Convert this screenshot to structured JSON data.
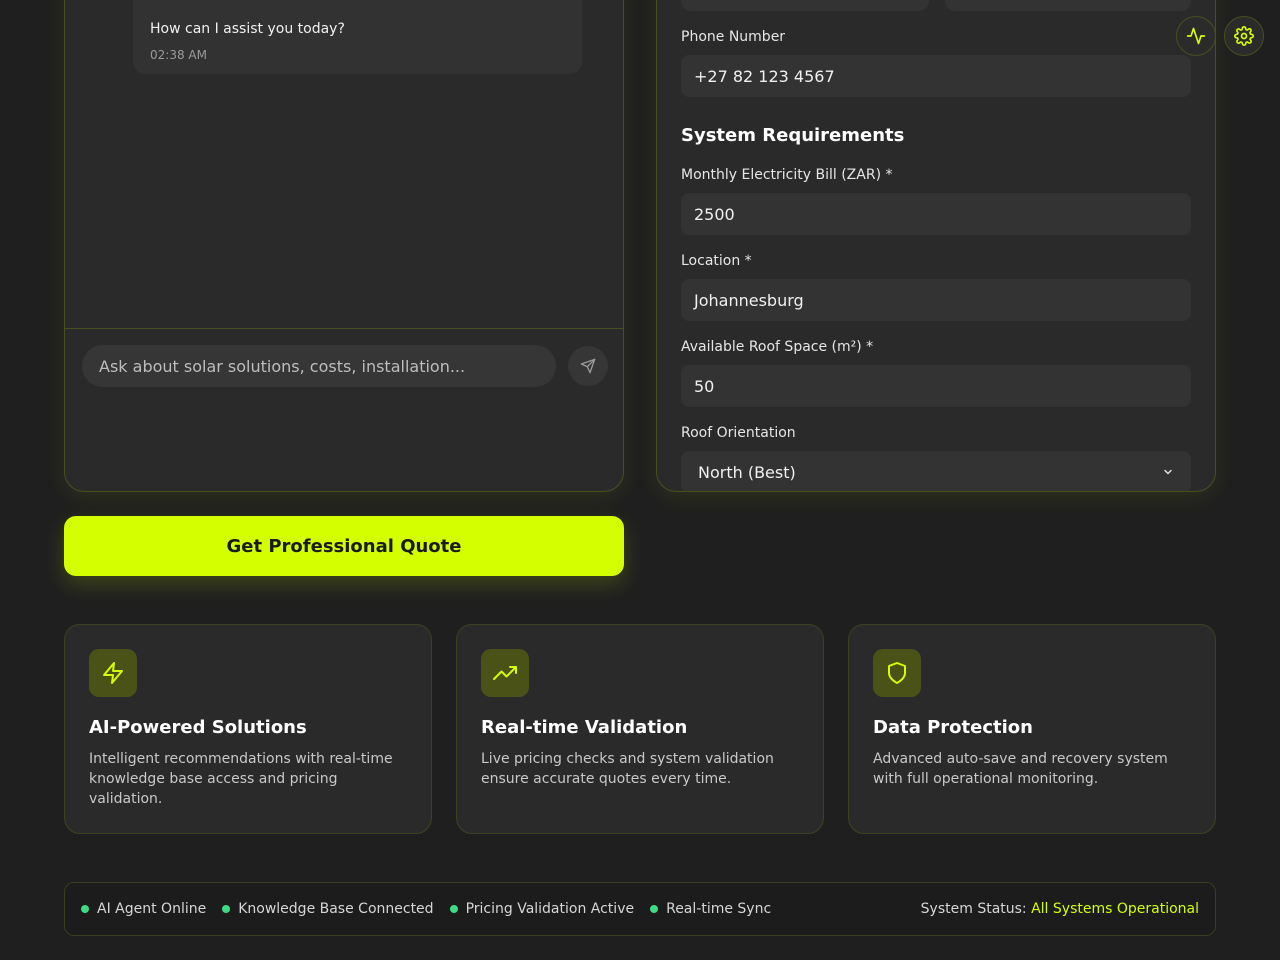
{
  "chat": {
    "message_text": "How can I assist you today?",
    "message_time": "02:38 AM",
    "input_placeholder": "Ask about solar solutions, costs, installation..."
  },
  "form": {
    "phone_label": "Phone Number",
    "phone_value": "+27 82 123 4567",
    "section_title": "System Requirements",
    "bill_label": "Monthly Electricity Bill (ZAR) *",
    "bill_value": "2500",
    "location_label": "Location *",
    "location_value": "Johannesburg",
    "roof_space_label": "Available Roof Space (m²) *",
    "roof_space_value": "50",
    "orientation_label": "Roof Orientation",
    "orientation_value": "North (Best)"
  },
  "quote_button": "Get Professional Quote",
  "features": [
    {
      "icon": "lightning-icon",
      "title": "AI-Powered Solutions",
      "desc": "Intelligent recommendations with real-time knowledge base access and pricing validation."
    },
    {
      "icon": "trending-up-icon",
      "title": "Real-time Validation",
      "desc": "Live pricing checks and system validation ensure accurate quotes every time."
    },
    {
      "icon": "shield-icon",
      "title": "Data Protection",
      "desc": "Advanced auto-save and recovery system with full operational monitoring."
    }
  ],
  "status": {
    "items": [
      "AI Agent Online",
      "Knowledge Base Connected",
      "Pricing Validation Active",
      "Real-time Sync"
    ],
    "system_label": "System Status:",
    "system_value": "All Systems Operational"
  },
  "colors": {
    "accent": "#d4ff00",
    "background": "#1f1f1f",
    "panel": "#2a2a2a",
    "online": "#3ddc84"
  }
}
